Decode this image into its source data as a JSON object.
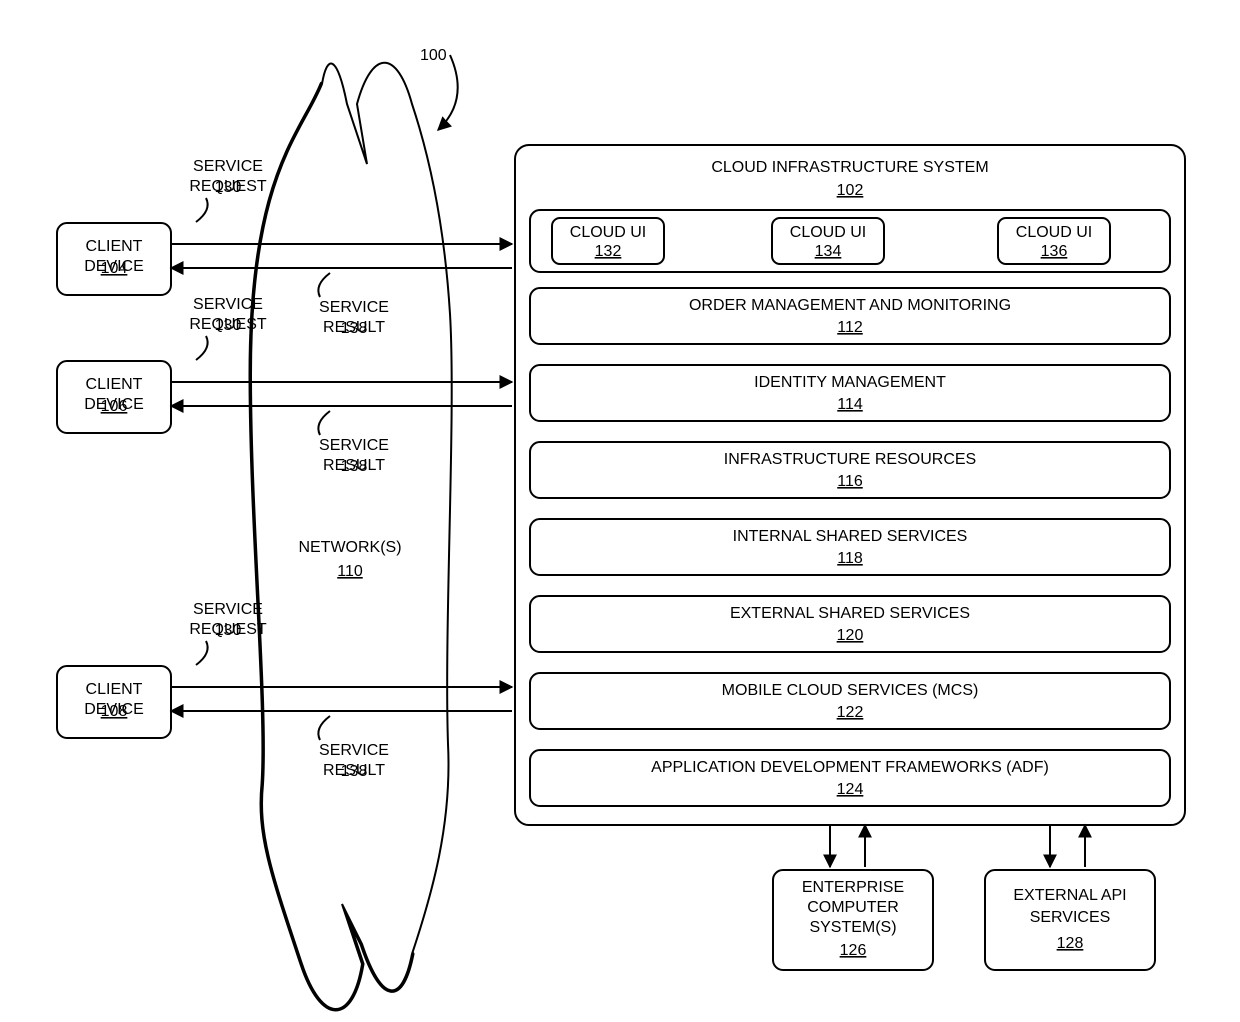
{
  "overall_ref": "100",
  "clients": [
    {
      "label": "CLIENT DEVICE",
      "ref": "104"
    },
    {
      "label": "CLIENT DEVICE",
      "ref": "106"
    },
    {
      "label": "CLIENT DEVICE",
      "ref": "108"
    }
  ],
  "network": {
    "label": "NETWORK(S)",
    "ref": "110"
  },
  "service_request": {
    "label": "SERVICE REQUEST",
    "ref": "130"
  },
  "service_result": {
    "label": "SERVICE RESULT",
    "ref": "138"
  },
  "cloud": {
    "title": "CLOUD INFRASTRUCTURE SYSTEM",
    "ref": "102",
    "ui": [
      {
        "label": "CLOUD UI",
        "ref": "132"
      },
      {
        "label": "CLOUD UI",
        "ref": "134"
      },
      {
        "label": "CLOUD UI",
        "ref": "136"
      }
    ],
    "subsystems": [
      {
        "label": "ORDER MANAGEMENT AND MONITORING",
        "ref": "112"
      },
      {
        "label": "IDENTITY MANAGEMENT",
        "ref": "114"
      },
      {
        "label": "INFRASTRUCTURE RESOURCES",
        "ref": "116"
      },
      {
        "label": "INTERNAL SHARED SERVICES",
        "ref": "118"
      },
      {
        "label": "EXTERNAL SHARED SERVICES",
        "ref": "120"
      },
      {
        "label": "MOBILE CLOUD SERVICES (MCS)",
        "ref": "122"
      },
      {
        "label": "APPLICATION DEVELOPMENT FRAMEWORKS (ADF)",
        "ref": "124"
      }
    ]
  },
  "enterprise": {
    "label1": "ENTERPRISE",
    "label2": "COMPUTER",
    "label3": "SYSTEM(S)",
    "ref": "126"
  },
  "external_api": {
    "label1": "EXTERNAL API",
    "label2": "SERVICES",
    "ref": "128"
  }
}
